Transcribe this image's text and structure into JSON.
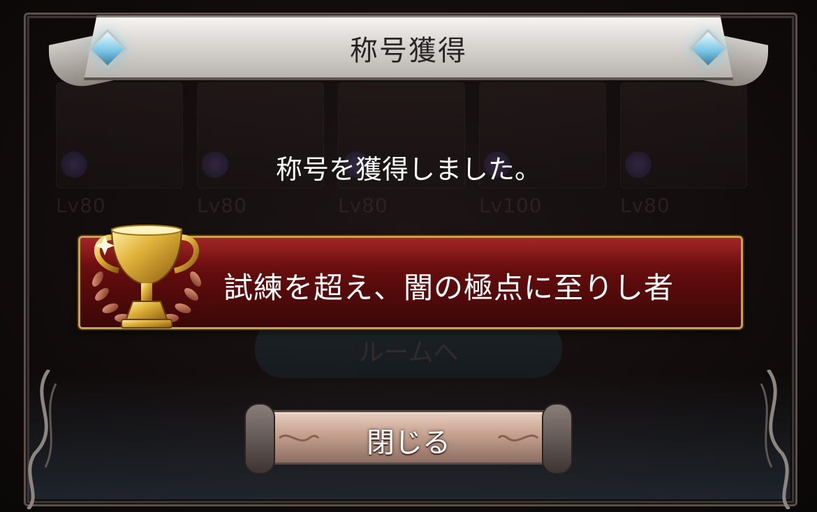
{
  "dialog": {
    "title": "称号獲得",
    "message": "称号を獲得しました。",
    "earned_title": "試練を超え、闇の極点に至りし者",
    "close_label": "閉じる"
  },
  "background": {
    "levels": [
      "Lv80",
      "Lv80",
      "Lv80",
      "Lv100",
      "Lv80"
    ],
    "button_label": "ルームへ"
  },
  "colors": {
    "plate": "#6e0e0e",
    "plate_border": "#c9a25a",
    "banner": "#dcd8d4",
    "gem": "#7cc6e6",
    "trophy_gold": "#d9a62b"
  },
  "icons": {
    "trophy": "trophy-icon",
    "gem": "diamond-gem-icon"
  }
}
